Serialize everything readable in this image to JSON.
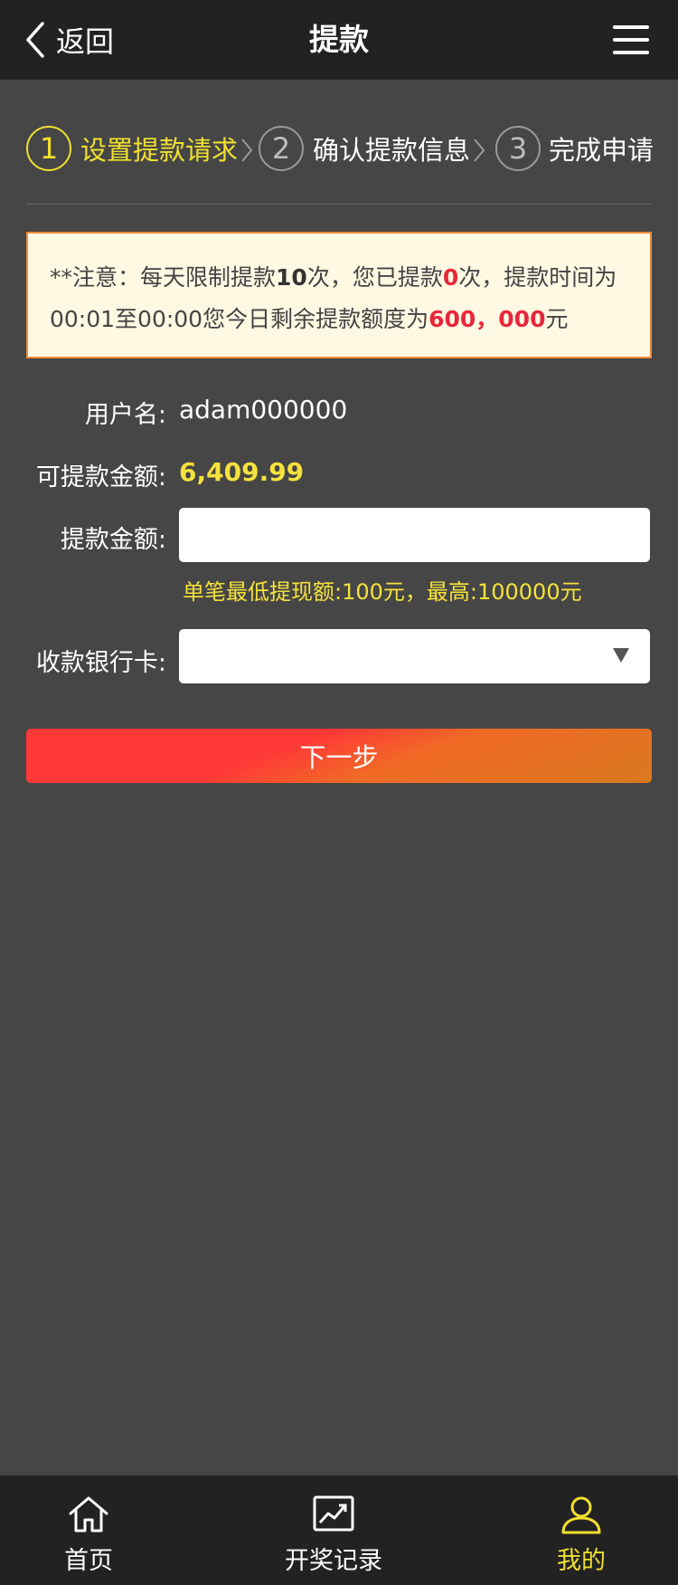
{
  "header": {
    "back_label": "返回",
    "title": "提款"
  },
  "steps": [
    {
      "number": "1",
      "label": "设置提款请求",
      "active": true
    },
    {
      "number": "2",
      "label": "确认提款信息",
      "active": false
    },
    {
      "number": "3",
      "label": "完成申请",
      "active": false
    }
  ],
  "notice": {
    "part1": "**注意：每天限制提款",
    "limit": "10",
    "part2": "次，您已提款",
    "used": "0",
    "part3": "次，提款时间为00:01至00:00您今日剩余提款额度为",
    "remaining": "600，000",
    "part4": "元"
  },
  "form": {
    "username_label": "用户名:",
    "username": "adam000000",
    "available_label": "可提款金额:",
    "available": "6,409.99",
    "amount_label": "提款金额:",
    "amount_value": "",
    "hint": "单笔最低提现额:100元，最高:100000元",
    "bank_label": "收款银行卡:",
    "bank_value": ""
  },
  "next_button": "下一步",
  "colors": {
    "accent_yellow": "#f0e030",
    "alert_red": "#e8273b",
    "background": "#464646",
    "bar": "#222222"
  },
  "tabbar": [
    {
      "label": "首页",
      "icon": "home-icon",
      "active": false
    },
    {
      "label": "开奖记录",
      "icon": "trend-chart-icon",
      "active": false
    },
    {
      "label": "我的",
      "icon": "user-icon",
      "active": true
    }
  ]
}
